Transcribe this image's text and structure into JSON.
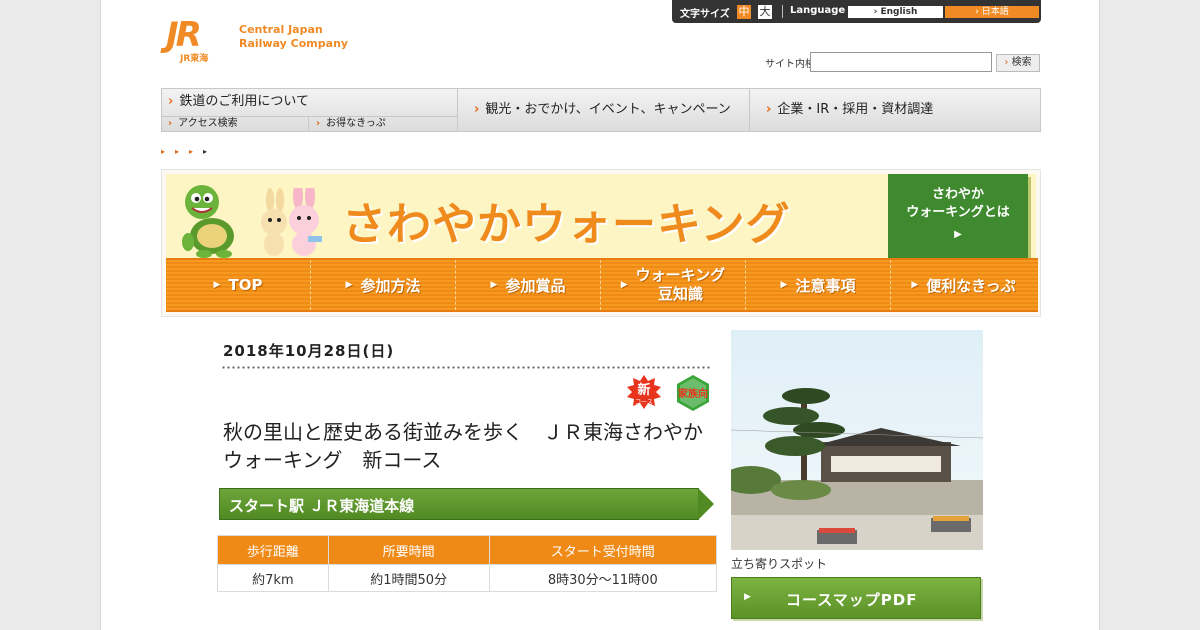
{
  "header": {
    "logo_mark": "JR",
    "logo_sub": "JR東海",
    "company_line1": "Central Japan",
    "company_line2": "Railway Company",
    "font_size_label": "文字サイズ",
    "font_size_mid": "中",
    "font_size_large": "大",
    "language_label": "Language",
    "lang_english": "English",
    "lang_japanese": "日本語",
    "search_label": "サイト内検索",
    "search_value": "",
    "search_button": "検索"
  },
  "mainnav": {
    "rail": "鉄道のご利用について",
    "rail_sub1": "アクセス検索",
    "rail_sub2": "お得なきっぷ",
    "travel": "観光・おでかけ、イベント、キャンペーン",
    "corp": "企業・IR・採用・資材調達"
  },
  "breadcrumb": [
    "▸",
    "▸",
    "▸",
    "▸"
  ],
  "banner": {
    "title": "さわやかウォーキング",
    "whatis_line1": "さわやか",
    "whatis_line2": "ウォーキングとは",
    "whatis_arrow": "▶",
    "nav": [
      {
        "label": "TOP"
      },
      {
        "label": "参加方法"
      },
      {
        "label": "参加賞品"
      },
      {
        "label_line1": "ウォーキング",
        "label_line2": "豆知識"
      },
      {
        "label": "注意事項"
      },
      {
        "label": "便利なきっぷ"
      }
    ],
    "nav_arrow": "▶"
  },
  "event": {
    "date": "2018年10月28日(日)",
    "badge_new": "新",
    "badge_new_sub": "コース",
    "badge_family": "家族向",
    "title": "秋の里山と歴史ある街並みを歩く　ＪＲ東海さわやかウォーキング　新コース",
    "ribbon": "スタート駅 ＪＲ東海道本線　",
    "table": {
      "headers": [
        "歩行距離",
        "所要時間",
        "スタート受付時間"
      ],
      "values": [
        "約7km",
        "約1時間50分",
        "8時30分～11時00"
      ]
    },
    "photo_caption": "立ち寄りスポット",
    "pdf_button": "コースマップPDF",
    "pdf_arrow": "▶"
  },
  "colors": {
    "brand_orange": "#ef8a17",
    "green": "#4f8a22"
  }
}
